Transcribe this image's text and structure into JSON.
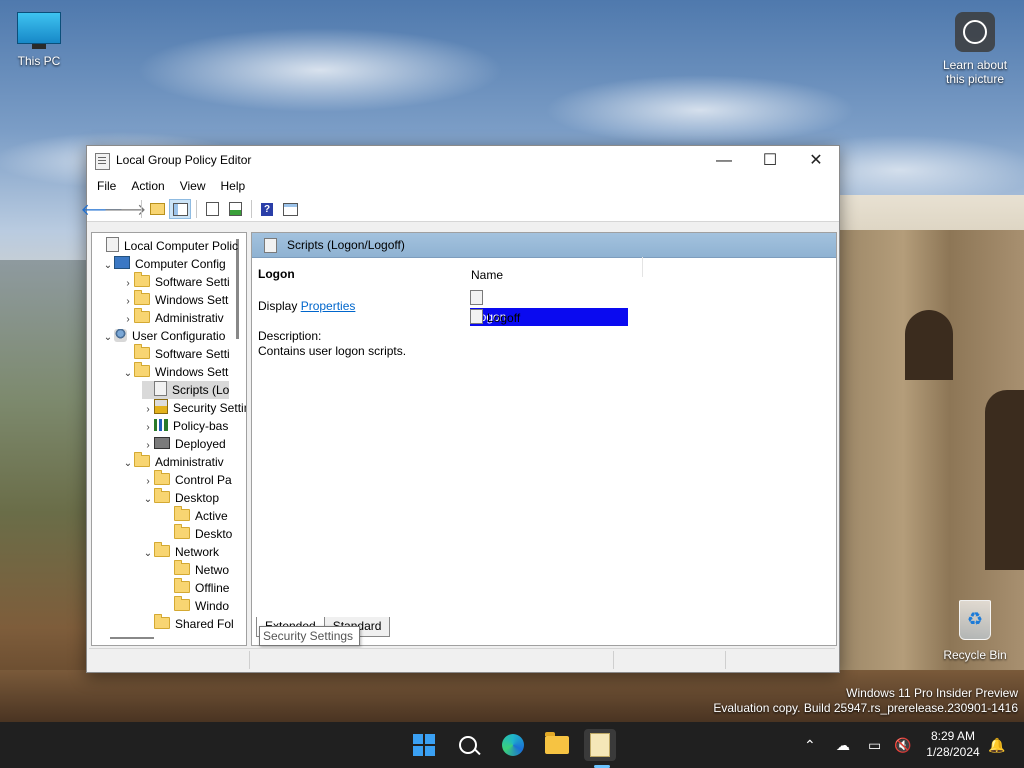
{
  "desktop": {
    "icons": {
      "this_pc": "This PC",
      "learn": "Learn about this picture",
      "recycle_bin": "Recycle Bin"
    },
    "watermark": {
      "line1": "Windows 11 Pro Insider Preview",
      "line2": "Evaluation copy. Build 25947.rs_prerelease.230901-1416"
    }
  },
  "window": {
    "title": "Local Group Policy Editor",
    "controls": {
      "minimize": "—",
      "maximize": "☐",
      "close": "✕"
    },
    "menu": [
      "File",
      "Action",
      "View",
      "Help"
    ],
    "toolbar_icons": [
      "back-arrow-icon",
      "forward-arrow-icon",
      "up-folder-icon",
      "show-hide-tree-icon",
      "properties-icon",
      "export-list-icon",
      "help-icon",
      "extended-view-icon"
    ],
    "tree": [
      {
        "label": "Local Computer Polic",
        "icon": "doc",
        "chev": ""
      },
      {
        "label": "Computer Config",
        "icon": "pc",
        "chev": "⌄"
      },
      {
        "label": "Software Setti",
        "icon": "folder",
        "chev": "›"
      },
      {
        "label": "Windows Sett",
        "icon": "folder",
        "chev": "›"
      },
      {
        "label": "Administrativ",
        "icon": "folder",
        "chev": "›"
      },
      {
        "label": "User Configuratio",
        "icon": "user",
        "chev": "⌄"
      },
      {
        "label": "Software Setti",
        "icon": "folder",
        "chev": ""
      },
      {
        "label": "Windows Sett",
        "icon": "folder",
        "chev": "⌄"
      },
      {
        "label": "Scripts (Lo",
        "icon": "doc",
        "chev": ""
      },
      {
        "label": "Security Settings",
        "icon": "lock",
        "chev": "›"
      },
      {
        "label": "Policy-bas",
        "icon": "bar",
        "chev": "›"
      },
      {
        "label": "Deployed",
        "icon": "deploy",
        "chev": "›"
      },
      {
        "label": "Administrativ",
        "icon": "folder",
        "chev": "⌄"
      },
      {
        "label": "Control Pa",
        "icon": "folder",
        "chev": "›"
      },
      {
        "label": "Desktop",
        "icon": "folder",
        "chev": "⌄"
      },
      {
        "label": "Active",
        "icon": "folder",
        "chev": ""
      },
      {
        "label": "Deskto",
        "icon": "folder",
        "chev": ""
      },
      {
        "label": "Network",
        "icon": "folder",
        "chev": "⌄"
      },
      {
        "label": "Netwo",
        "icon": "folder",
        "chev": ""
      },
      {
        "label": "Offline",
        "icon": "folder",
        "chev": ""
      },
      {
        "label": "Windo",
        "icon": "folder",
        "chev": ""
      },
      {
        "label": "Shared Fol",
        "icon": "folder",
        "chev": ""
      }
    ],
    "tooltip": "Security Settings",
    "right": {
      "header": "Scripts (Logon/Logoff)",
      "item_name": "Logon",
      "display_prefix": "Display ",
      "properties_link": "Properties",
      "description_label": "Description:",
      "description": "Contains user logon scripts.",
      "column_name": "Name",
      "rows": [
        "Logon",
        "Logoff"
      ],
      "tabs": [
        "Extended",
        "Standard"
      ]
    }
  },
  "taskbar": {
    "apps": [
      "start-icon",
      "search-icon",
      "edge-beta-icon",
      "file-explorer-icon",
      "group-policy-icon"
    ],
    "time": "8:29 AM",
    "date": "1/28/2024",
    "tray": [
      "chevron-up-icon",
      "onedrive-off-icon",
      "display-icon",
      "volume-muted-icon",
      "notification-bell-icon"
    ]
  },
  "colors": {
    "accent": "#0a0af0",
    "link": "#0066cc",
    "taskbar": "#202020",
    "header_gradient": "#a3c2de"
  }
}
